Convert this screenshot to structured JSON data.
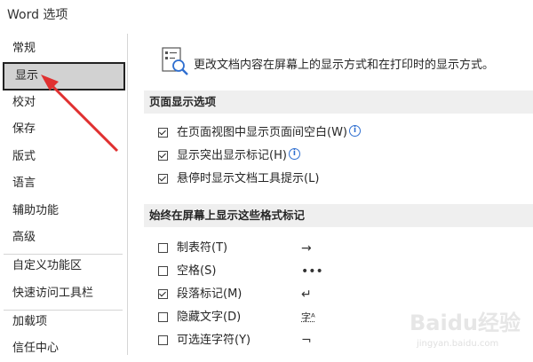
{
  "window": {
    "title": "Word 选项"
  },
  "sidebar": {
    "items": [
      {
        "label": "常规"
      },
      {
        "label": "显示"
      },
      {
        "label": "校对"
      },
      {
        "label": "保存"
      },
      {
        "label": "版式"
      },
      {
        "label": "语言"
      },
      {
        "label": "辅助功能"
      },
      {
        "label": "高级"
      },
      {
        "label": "自定义功能区"
      },
      {
        "label": "快速访问工具栏"
      },
      {
        "label": "加载项"
      },
      {
        "label": "信任中心"
      }
    ]
  },
  "main": {
    "intro_text": "更改文档内容在屏幕上的显示方式和在打印时的显示方式。",
    "section1": {
      "title": "页面显示选项",
      "options": [
        {
          "label": "在页面视图中显示页面间空白(W)",
          "info": "i"
        },
        {
          "label": "显示突出显示标记(H)",
          "info": "i"
        },
        {
          "label": "悬停时显示文档工具提示(L)"
        }
      ]
    },
    "section2": {
      "title": "始终在屏幕上显示这些格式标记",
      "options": [
        {
          "label": "制表符(T)",
          "mark": "→"
        },
        {
          "label": "空格(S)",
          "mark": "•••"
        },
        {
          "label": "段落标记(M)",
          "mark": "↵"
        },
        {
          "label": "隐藏文字(D)",
          "mark": "字ᴬ"
        },
        {
          "label": "可选连字符(Y)",
          "mark": "¬"
        }
      ]
    }
  },
  "colors": {
    "selected_bg": "#d2d2d2",
    "section_bg": "#efefef",
    "arrow": "#e03030",
    "info": "#2f6fd0"
  },
  "watermark": {
    "text": "Baidu经验",
    "subtext": "jingyan.baidu.com"
  }
}
